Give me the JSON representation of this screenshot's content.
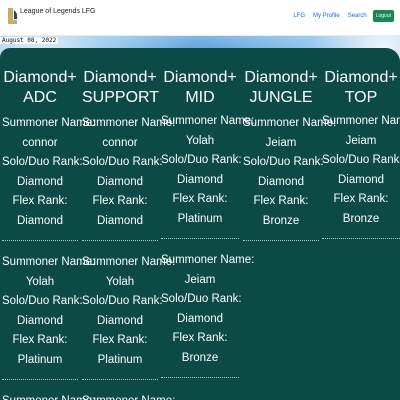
{
  "navbar": {
    "brand": "League of Legends LFG",
    "links": [
      "LFG",
      "My Profile",
      "Search"
    ],
    "logout_label": "Logout"
  },
  "date": "August 08, 2022",
  "labels": {
    "summoner": "Summoner Name:",
    "solo_duo": "Solo/Duo Rank:",
    "flex": "Flex Rank:"
  },
  "columns": [
    {
      "title_line1": "Diamond+",
      "title_line2": "ADC",
      "entries": [
        {
          "name": "connor",
          "solo": "Diamond",
          "flex": "Diamond"
        },
        {
          "name": "Yolah",
          "solo": "Diamond",
          "flex": "Platinum"
        },
        {
          "name": "",
          "solo": "",
          "flex": ""
        }
      ]
    },
    {
      "title_line1": "Diamond+",
      "title_line2": "SUPPORT",
      "entries": [
        {
          "name": "connor",
          "solo": "Diamond",
          "flex": "Diamond"
        },
        {
          "name": "Yolah",
          "solo": "Diamond",
          "flex": "Platinum"
        },
        {
          "name": "",
          "solo": "",
          "flex": ""
        }
      ]
    },
    {
      "title_line1": "Diamond+ MID",
      "entries": [
        {
          "name": "Yolah",
          "solo": "Diamond",
          "flex": "Platinum"
        },
        {
          "name": "Jeiam",
          "solo": "Diamond",
          "flex": "Bronze"
        }
      ]
    },
    {
      "title_line1": "Diamond+",
      "title_line2": "JUNGLE",
      "entries": [
        {
          "name": "Jeiam",
          "solo": "Diamond",
          "flex": "Bronze"
        }
      ]
    },
    {
      "title_line1": "Diamond+ TOP",
      "entries": [
        {
          "name": "Jeiam",
          "solo": "Diamond",
          "flex": "Bronze"
        }
      ]
    }
  ]
}
